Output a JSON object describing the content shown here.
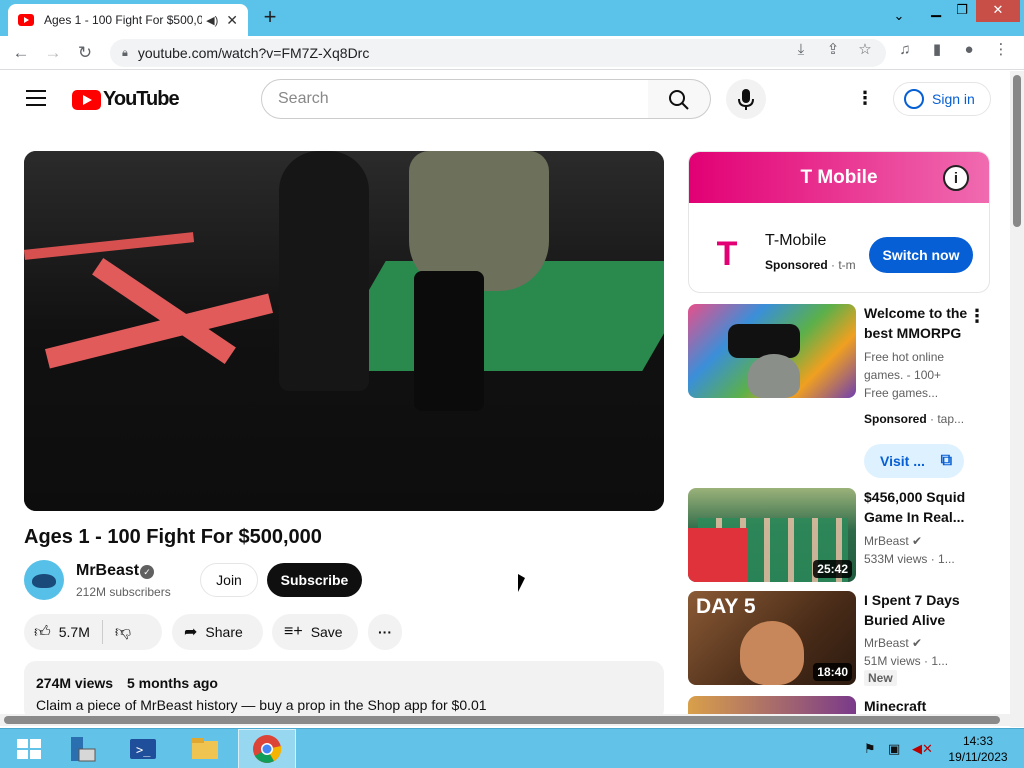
{
  "browser": {
    "tab_title": "Ages 1 - 100 Fight For $500,0",
    "url": "youtube.com/watch?v=FM7Z-Xq8Drc",
    "new_tab": "+",
    "close_tab": "✕"
  },
  "header": {
    "logo_text": "YouTube",
    "search_placeholder": "Search",
    "sign_in": "Sign in"
  },
  "video": {
    "title": "Ages 1 - 100 Fight For $500,000",
    "channel": "MrBeast",
    "subscribers": "212M subscribers",
    "join": "Join",
    "subscribe": "Subscribe",
    "likes": "5.7M",
    "share": "Share",
    "save": "Save",
    "views": "274M views",
    "age": "5 months ago",
    "description": "Claim a piece of MrBeast history — buy a prop in the Shop app for $0.01"
  },
  "ad": {
    "banner": "T Mobile",
    "logo": "T",
    "name": "T-Mobile",
    "sponsored": "Sponsored",
    "domain": "t-m",
    "cta": "Switch now"
  },
  "recommendations": [
    {
      "title": "Welcome to the best MMORPG",
      "line1": "Free hot online",
      "line2": "games. - 100+",
      "line3": "Free games...",
      "sponsored": "Sponsored",
      "domain": "tap...",
      "cta": "Visit ..."
    },
    {
      "title": "$456,000 Squid Game In Real...",
      "channel": "MrBeast",
      "meta": "533M views",
      "age": "1...",
      "duration": "25:42"
    },
    {
      "title": "I Spent 7 Days Buried Alive",
      "channel": "MrBeast",
      "meta": "51M views",
      "age": "1...",
      "badge": "New",
      "duration": "18:40",
      "thumb_text": "DAY 5"
    },
    {
      "title": "Minecraft"
    }
  ],
  "taskbar": {
    "time": "14:33",
    "date": "19/11/2023"
  }
}
